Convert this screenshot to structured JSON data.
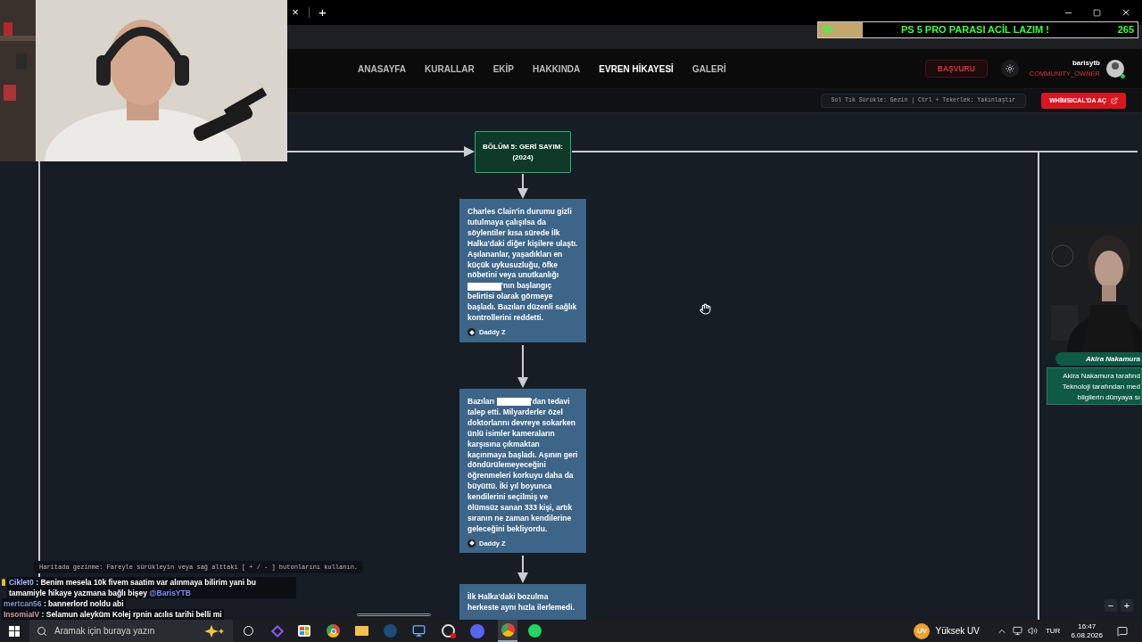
{
  "browser": {
    "tab_close": "×",
    "new_tab": "+"
  },
  "donation_goal": {
    "current": "38",
    "title": "PS 5 PRO PARASI ACİL LAZIM !",
    "target": "265",
    "level": 0.14
  },
  "nav": {
    "links": [
      {
        "label": "ANASAYFA",
        "selected": false
      },
      {
        "label": "KURALLAR",
        "selected": false
      },
      {
        "label": "EKİP",
        "selected": false
      },
      {
        "label": "HAKKINDA",
        "selected": false
      },
      {
        "label": "EVREN HİKAYESİ",
        "selected": true
      },
      {
        "label": "GALERİ",
        "selected": false
      }
    ],
    "apply_button": "BAŞVURU",
    "user": {
      "name": "barisytb",
      "role": "COMMUNITY_OWNER",
      "online": true
    }
  },
  "toolbar": {
    "hint": "Sol Tık Sürükle: Gezin | Ctrl + Tekerlek: Yakınlaştır",
    "open_button": "WHİMSICAL'DA AÇ"
  },
  "map": {
    "chapter": "BÖLÜM 5: GERİ SAYIM: (2024)",
    "cards": [
      {
        "parts": [
          {
            "kind": "text",
            "text": "Charles Clain'in durumu gizli tutulmaya çalışılsa da söylentiler kısa sürede İlk Halka'daki diğer kişilere ulaştı. Aşılananlar, yaşadıkları en küçük uykusuzluğu, öfke nöbetini veya unutkanlığı "
          },
          {
            "kind": "redacted"
          },
          {
            "kind": "text",
            "text": "'nın başlangıç belirtisi olarak görmeye başladı. Bazıları düzenli sağlık kontrollerini reddetti."
          }
        ],
        "author": "Daddy Z"
      },
      {
        "parts": [
          {
            "kind": "text",
            "text": "Bazıları "
          },
          {
            "kind": "redacted"
          },
          {
            "kind": "text",
            "text": "'dan tedavi talep etti. Milyarderler özel doktorlarını devreye sokarken ünlü isimler kameraların karşısına çıkmaktan kaçınmaya başladı. Aşının geri döndürülemeyeceğini öğrenmeleri korkuyu daha da büyüttü. İki yıl boyunca kendilerini seçilmiş ve ölümsüz sanan 333 kişi, artık sıranın ne zaman kendilerine geleceğini bekliyordu."
          }
        ],
        "author": "Daddy Z"
      },
      {
        "parts": [
          {
            "kind": "text",
            "text": "İlk Halka'daki bozulma herkeste aynı hızla ilerlemedi."
          }
        ]
      }
    ],
    "character": {
      "name": "Akira Nakamura",
      "lines": [
        "Akira Nakamura tarafınd",
        "Teknoloji tarafından med",
        "bilgilerin dünyaya sı"
      ]
    },
    "hint": "Haritada gezinme: Fareyle sürükleyin veya sağ alttaki [ + / - ] butonlarını kullanın.",
    "zoom_out": "−",
    "zoom_in": "+"
  },
  "chat": [
    {
      "user": "Ciklet0",
      "color": "#a9b8ff",
      "badge": true,
      "text": ": Benim mesela 10k fivem saatim var alınmaya bilirim yani bu tamamiyle hikaye yazmana bağlı bişey",
      "mention": "@BarisYTB"
    },
    {
      "user": "mertcan56",
      "color": "#7f8fc8",
      "badge": false,
      "text": ": bannerlord noldu abi"
    },
    {
      "user": "InsomiaIV",
      "color": "#c99a9a",
      "badge": false,
      "text": ": Selamun aleyküm Kolej rpnin acılıs tarihi belli mi"
    }
  ],
  "taskbar": {
    "search_placeholder": "Aramak için buraya yazın",
    "weather": "Yüksek UV",
    "weather_badge": "UV",
    "language": "TUR",
    "time": "16:47",
    "date": "6.08.2026"
  }
}
